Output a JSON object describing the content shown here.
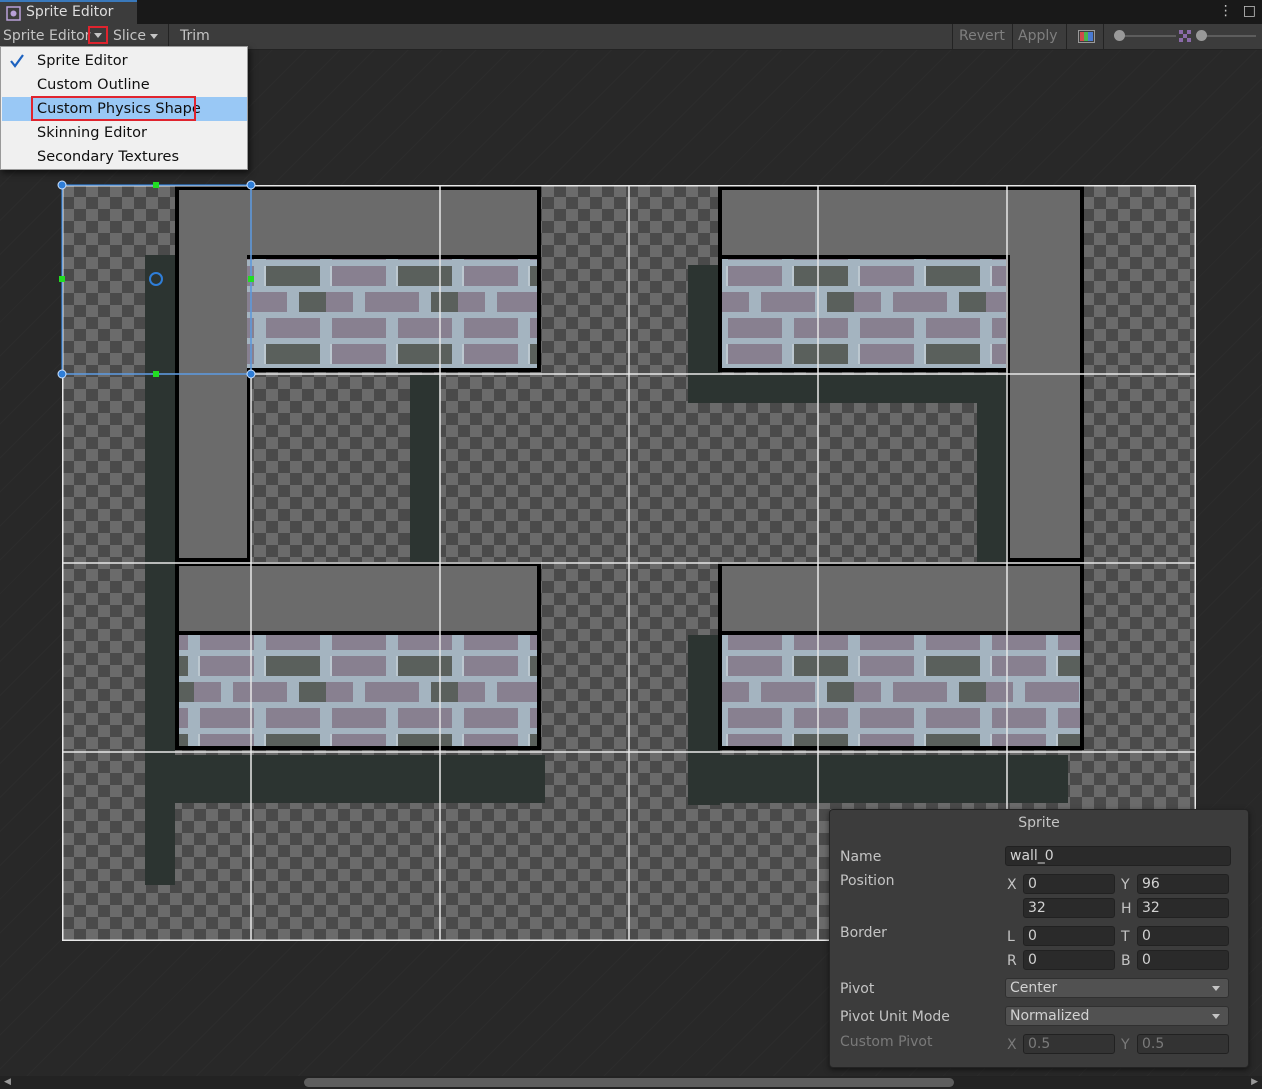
{
  "window": {
    "tab_title": "Sprite Editor",
    "menu_icon": "kebab-menu-icon",
    "maximize_icon": "maximize-icon"
  },
  "toolbar": {
    "mode_label": "Sprite Editor",
    "slice_label": "Slice",
    "trim_label": "Trim",
    "revert_label": "Revert",
    "apply_label": "Apply"
  },
  "mode_menu": {
    "items": [
      {
        "label": "Sprite Editor",
        "checked": true
      },
      {
        "label": "Custom Outline",
        "checked": false
      },
      {
        "label": "Custom Physics Shape",
        "checked": false,
        "highlighted": true
      },
      {
        "label": "Skinning Editor",
        "checked": false
      },
      {
        "label": "Secondary Textures",
        "checked": false
      }
    ]
  },
  "sprite_panel": {
    "title": "Sprite",
    "name_label": "Name",
    "name_value": "wall_0",
    "position_label": "Position",
    "x_label": "X",
    "x_value": "0",
    "y_label": "Y",
    "y_value": "96",
    "w_value": "32",
    "h_label": "H",
    "h_value": "32",
    "border_label": "Border",
    "l_label": "L",
    "l_value": "0",
    "t_label": "T",
    "t_value": "0",
    "r_label": "R",
    "r_value": "0",
    "b_label": "B",
    "b_value": "0",
    "pivot_label": "Pivot",
    "pivot_value": "Center",
    "pivot_unit_label": "Pivot Unit Mode",
    "pivot_unit_value": "Normalized",
    "custom_pivot_label": "Custom Pivot",
    "cp_x_label": "X",
    "cp_x_value": "0.5",
    "cp_y_label": "Y",
    "cp_y_value": "0.5"
  },
  "colors": {
    "accent": "#3a79bb",
    "highlight": "#99c8f5",
    "callout": "#e0242e",
    "selection": "#2f7ed8"
  }
}
